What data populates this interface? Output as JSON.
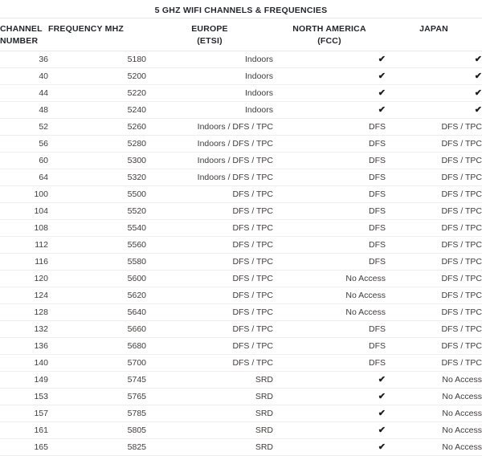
{
  "title": "5 GHZ WIFI CHANNELS & FREQUENCIES",
  "colors": {
    "title_text": "#23262b",
    "header_text": "#23262b",
    "body_text": "#3f3b39",
    "row_border": "#ededed",
    "header_border": "#e6e6e6",
    "check_mark": "#1c1c1c",
    "background": "#ffffff"
  },
  "columns": [
    {
      "key": "channel",
      "line1": "CHANNEL",
      "line2": "NUMBER"
    },
    {
      "key": "frequency",
      "line1": "FREQUENCY MHZ",
      "line2": ""
    },
    {
      "key": "europe",
      "line1": "EUROPE",
      "line2": "(ETSI)"
    },
    {
      "key": "north_america",
      "line1": "NORTH AMERICA",
      "line2": "(FCC)"
    },
    {
      "key": "japan",
      "line1": "JAPAN",
      "line2": ""
    }
  ],
  "check_glyph": "✔",
  "rows": [
    {
      "channel": "36",
      "frequency": "5180",
      "europe": "Indoors",
      "north_america": "✔",
      "japan": "✔"
    },
    {
      "channel": "40",
      "frequency": "5200",
      "europe": "Indoors",
      "north_america": "✔",
      "japan": "✔"
    },
    {
      "channel": "44",
      "frequency": "5220",
      "europe": "Indoors",
      "north_america": "✔",
      "japan": "✔"
    },
    {
      "channel": "48",
      "frequency": "5240",
      "europe": "Indoors",
      "north_america": "✔",
      "japan": "✔"
    },
    {
      "channel": "52",
      "frequency": "5260",
      "europe": "Indoors / DFS / TPC",
      "north_america": "DFS",
      "japan": "DFS / TPC"
    },
    {
      "channel": "56",
      "frequency": "5280",
      "europe": "Indoors / DFS / TPC",
      "north_america": "DFS",
      "japan": "DFS / TPC"
    },
    {
      "channel": "60",
      "frequency": "5300",
      "europe": "Indoors / DFS / TPC",
      "north_america": "DFS",
      "japan": "DFS / TPC"
    },
    {
      "channel": "64",
      "frequency": "5320",
      "europe": "Indoors / DFS / TPC",
      "north_america": "DFS",
      "japan": "DFS / TPC"
    },
    {
      "channel": "100",
      "frequency": "5500",
      "europe": "DFS / TPC",
      "north_america": "DFS",
      "japan": "DFS / TPC"
    },
    {
      "channel": "104",
      "frequency": "5520",
      "europe": "DFS / TPC",
      "north_america": "DFS",
      "japan": "DFS / TPC"
    },
    {
      "channel": "108",
      "frequency": "5540",
      "europe": "DFS / TPC",
      "north_america": "DFS",
      "japan": "DFS / TPC"
    },
    {
      "channel": "112",
      "frequency": "5560",
      "europe": "DFS / TPC",
      "north_america": "DFS",
      "japan": "DFS / TPC"
    },
    {
      "channel": "116",
      "frequency": "5580",
      "europe": "DFS / TPC",
      "north_america": "DFS",
      "japan": "DFS / TPC"
    },
    {
      "channel": "120",
      "frequency": "5600",
      "europe": "DFS / TPC",
      "north_america": "No Access",
      "japan": "DFS / TPC"
    },
    {
      "channel": "124",
      "frequency": "5620",
      "europe": "DFS / TPC",
      "north_america": "No Access",
      "japan": "DFS / TPC"
    },
    {
      "channel": "128",
      "frequency": "5640",
      "europe": "DFS / TPC",
      "north_america": "No Access",
      "japan": "DFS / TPC"
    },
    {
      "channel": "132",
      "frequency": "5660",
      "europe": "DFS / TPC",
      "north_america": "DFS",
      "japan": "DFS / TPC"
    },
    {
      "channel": "136",
      "frequency": "5680",
      "europe": "DFS / TPC",
      "north_america": "DFS",
      "japan": "DFS / TPC"
    },
    {
      "channel": "140",
      "frequency": "5700",
      "europe": "DFS / TPC",
      "north_america": "DFS",
      "japan": "DFS / TPC"
    },
    {
      "channel": "149",
      "frequency": "5745",
      "europe": "SRD",
      "north_america": "✔",
      "japan": "No Access"
    },
    {
      "channel": "153",
      "frequency": "5765",
      "europe": "SRD",
      "north_america": "✔",
      "japan": "No Access"
    },
    {
      "channel": "157",
      "frequency": "5785",
      "europe": "SRD",
      "north_america": "✔",
      "japan": "No Access"
    },
    {
      "channel": "161",
      "frequency": "5805",
      "europe": "SRD",
      "north_america": "✔",
      "japan": "No Access"
    },
    {
      "channel": "165",
      "frequency": "5825",
      "europe": "SRD",
      "north_america": "✔",
      "japan": "No Access"
    }
  ]
}
